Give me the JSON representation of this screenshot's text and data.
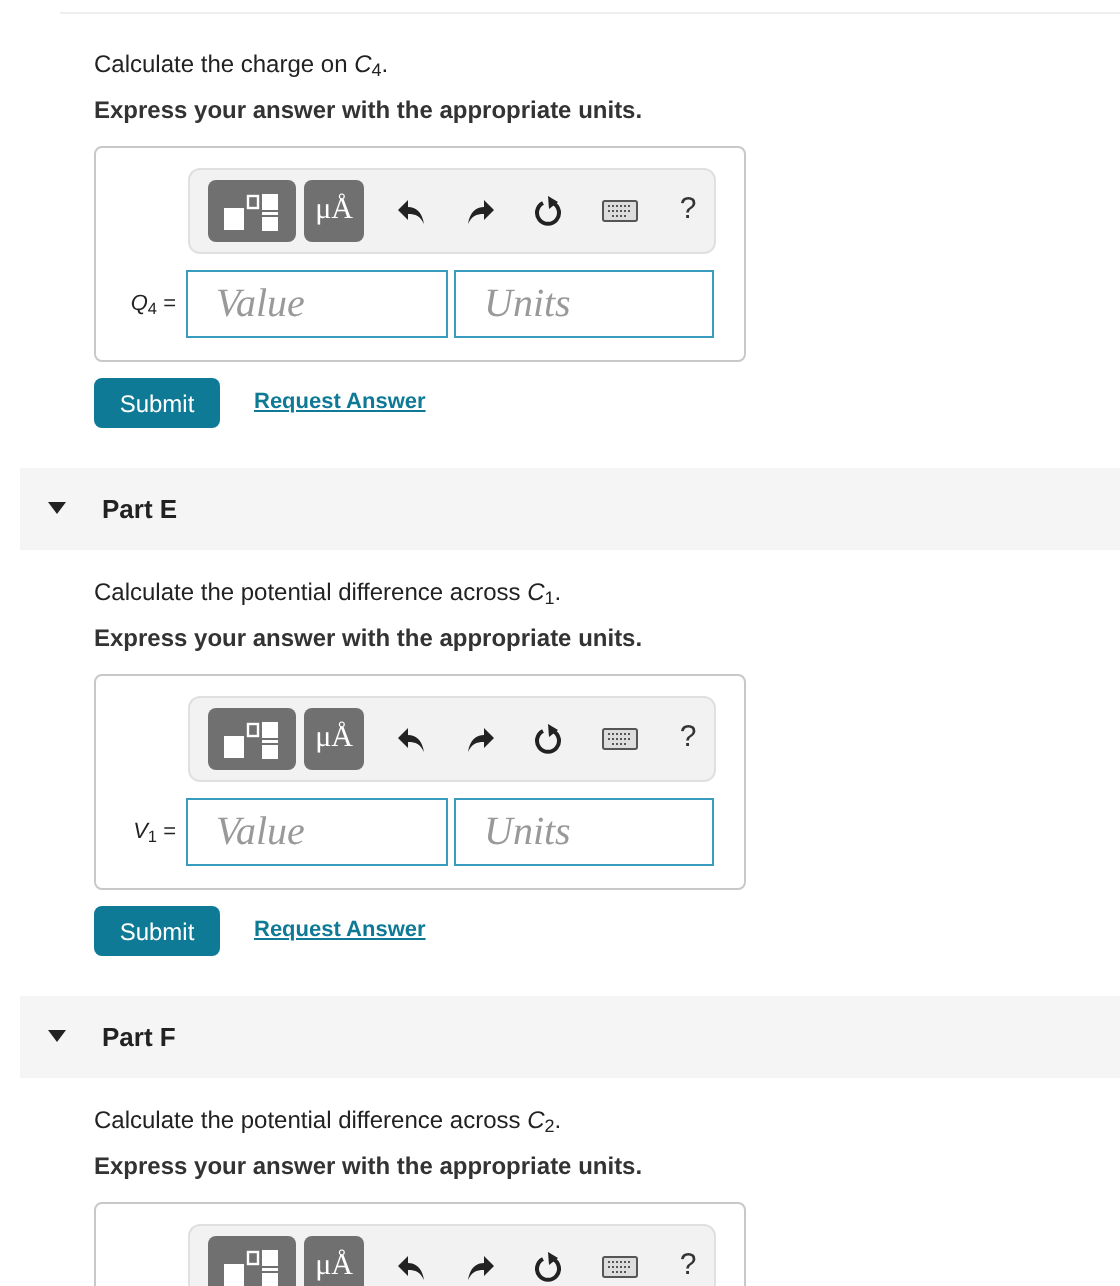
{
  "parts": [
    {
      "question": "Calculate the charge on *C*$_{4}$.",
      "instruction": "Express your answer with the appropriate units.",
      "toolbar": {
        "units_button": "μÅ",
        "help": "?"
      },
      "answer": {
        "label": "*Q*$_{4}$ =",
        "value_placeholder": "Value",
        "units_placeholder": "Units"
      },
      "submit": "Submit",
      "request": "Request Answer"
    },
    {
      "title": "Part E",
      "expanded": true,
      "question": "Calculate the potential difference across *C*$_{1}$.",
      "instruction": "Express your answer with the appropriate units.",
      "toolbar": {
        "units_button": "μÅ",
        "help": "?"
      },
      "answer": {
        "label": "*V*$_{1}$ =",
        "value_placeholder": "Value",
        "units_placeholder": "Units"
      },
      "submit": "Submit",
      "request": "Request Answer"
    },
    {
      "title": "Part F",
      "expanded": true,
      "question": "Calculate the potential difference across *C*$_{2}$.",
      "instruction": "Express your answer with the appropriate units.",
      "toolbar": {
        "units_button": "μÅ",
        "help": "?"
      }
    }
  ]
}
